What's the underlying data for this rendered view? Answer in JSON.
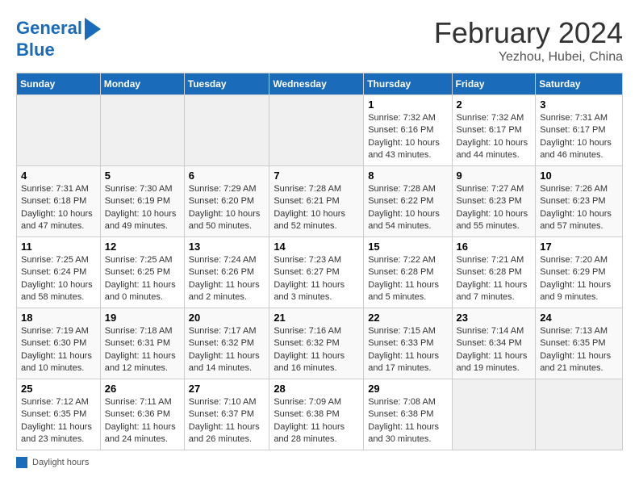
{
  "header": {
    "logo_line1": "General",
    "logo_line2": "Blue",
    "title": "February 2024",
    "subtitle": "Yezhou, Hubei, China"
  },
  "days_of_week": [
    "Sunday",
    "Monday",
    "Tuesday",
    "Wednesday",
    "Thursday",
    "Friday",
    "Saturday"
  ],
  "weeks": [
    [
      {
        "day": "",
        "content": ""
      },
      {
        "day": "",
        "content": ""
      },
      {
        "day": "",
        "content": ""
      },
      {
        "day": "",
        "content": ""
      },
      {
        "day": "1",
        "content": "Sunrise: 7:32 AM\nSunset: 6:16 PM\nDaylight: 10 hours and 43 minutes."
      },
      {
        "day": "2",
        "content": "Sunrise: 7:32 AM\nSunset: 6:17 PM\nDaylight: 10 hours and 44 minutes."
      },
      {
        "day": "3",
        "content": "Sunrise: 7:31 AM\nSunset: 6:17 PM\nDaylight: 10 hours and 46 minutes."
      }
    ],
    [
      {
        "day": "4",
        "content": "Sunrise: 7:31 AM\nSunset: 6:18 PM\nDaylight: 10 hours and 47 minutes."
      },
      {
        "day": "5",
        "content": "Sunrise: 7:30 AM\nSunset: 6:19 PM\nDaylight: 10 hours and 49 minutes."
      },
      {
        "day": "6",
        "content": "Sunrise: 7:29 AM\nSunset: 6:20 PM\nDaylight: 10 hours and 50 minutes."
      },
      {
        "day": "7",
        "content": "Sunrise: 7:28 AM\nSunset: 6:21 PM\nDaylight: 10 hours and 52 minutes."
      },
      {
        "day": "8",
        "content": "Sunrise: 7:28 AM\nSunset: 6:22 PM\nDaylight: 10 hours and 54 minutes."
      },
      {
        "day": "9",
        "content": "Sunrise: 7:27 AM\nSunset: 6:23 PM\nDaylight: 10 hours and 55 minutes."
      },
      {
        "day": "10",
        "content": "Sunrise: 7:26 AM\nSunset: 6:23 PM\nDaylight: 10 hours and 57 minutes."
      }
    ],
    [
      {
        "day": "11",
        "content": "Sunrise: 7:25 AM\nSunset: 6:24 PM\nDaylight: 10 hours and 58 minutes."
      },
      {
        "day": "12",
        "content": "Sunrise: 7:25 AM\nSunset: 6:25 PM\nDaylight: 11 hours and 0 minutes."
      },
      {
        "day": "13",
        "content": "Sunrise: 7:24 AM\nSunset: 6:26 PM\nDaylight: 11 hours and 2 minutes."
      },
      {
        "day": "14",
        "content": "Sunrise: 7:23 AM\nSunset: 6:27 PM\nDaylight: 11 hours and 3 minutes."
      },
      {
        "day": "15",
        "content": "Sunrise: 7:22 AM\nSunset: 6:28 PM\nDaylight: 11 hours and 5 minutes."
      },
      {
        "day": "16",
        "content": "Sunrise: 7:21 AM\nSunset: 6:28 PM\nDaylight: 11 hours and 7 minutes."
      },
      {
        "day": "17",
        "content": "Sunrise: 7:20 AM\nSunset: 6:29 PM\nDaylight: 11 hours and 9 minutes."
      }
    ],
    [
      {
        "day": "18",
        "content": "Sunrise: 7:19 AM\nSunset: 6:30 PM\nDaylight: 11 hours and 10 minutes."
      },
      {
        "day": "19",
        "content": "Sunrise: 7:18 AM\nSunset: 6:31 PM\nDaylight: 11 hours and 12 minutes."
      },
      {
        "day": "20",
        "content": "Sunrise: 7:17 AM\nSunset: 6:32 PM\nDaylight: 11 hours and 14 minutes."
      },
      {
        "day": "21",
        "content": "Sunrise: 7:16 AM\nSunset: 6:32 PM\nDaylight: 11 hours and 16 minutes."
      },
      {
        "day": "22",
        "content": "Sunrise: 7:15 AM\nSunset: 6:33 PM\nDaylight: 11 hours and 17 minutes."
      },
      {
        "day": "23",
        "content": "Sunrise: 7:14 AM\nSunset: 6:34 PM\nDaylight: 11 hours and 19 minutes."
      },
      {
        "day": "24",
        "content": "Sunrise: 7:13 AM\nSunset: 6:35 PM\nDaylight: 11 hours and 21 minutes."
      }
    ],
    [
      {
        "day": "25",
        "content": "Sunrise: 7:12 AM\nSunset: 6:35 PM\nDaylight: 11 hours and 23 minutes."
      },
      {
        "day": "26",
        "content": "Sunrise: 7:11 AM\nSunset: 6:36 PM\nDaylight: 11 hours and 24 minutes."
      },
      {
        "day": "27",
        "content": "Sunrise: 7:10 AM\nSunset: 6:37 PM\nDaylight: 11 hours and 26 minutes."
      },
      {
        "day": "28",
        "content": "Sunrise: 7:09 AM\nSunset: 6:38 PM\nDaylight: 11 hours and 28 minutes."
      },
      {
        "day": "29",
        "content": "Sunrise: 7:08 AM\nSunset: 6:38 PM\nDaylight: 11 hours and 30 minutes."
      },
      {
        "day": "",
        "content": ""
      },
      {
        "day": "",
        "content": ""
      }
    ]
  ],
  "legend": {
    "color_label": "Daylight hours"
  }
}
